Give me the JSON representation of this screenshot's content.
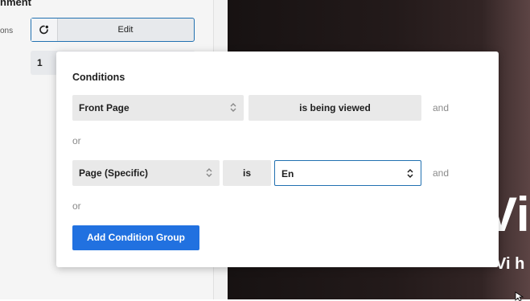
{
  "sidebar": {
    "section_title": "nment",
    "conditions_label": "ons",
    "edit_button": "Edit",
    "item_number": "1"
  },
  "preview": {
    "hero_title": "Vi",
    "hero_subtitle": "Vi h"
  },
  "conditions_popover": {
    "title": "Conditions",
    "groups": [
      {
        "subject": "Front Page",
        "operator": "is being viewed",
        "and_label": "and"
      },
      {
        "subject": "Page (Specific)",
        "operator": "is",
        "value": "En",
        "and_label": "and"
      }
    ],
    "or_labels": [
      "or",
      "or"
    ],
    "add_group_button": "Add Condition Group"
  },
  "colors": {
    "accent": "#2171e0",
    "focus_border": "#2271b1",
    "field_bg": "#e9e9e9",
    "muted_text": "#8a8a8a"
  }
}
